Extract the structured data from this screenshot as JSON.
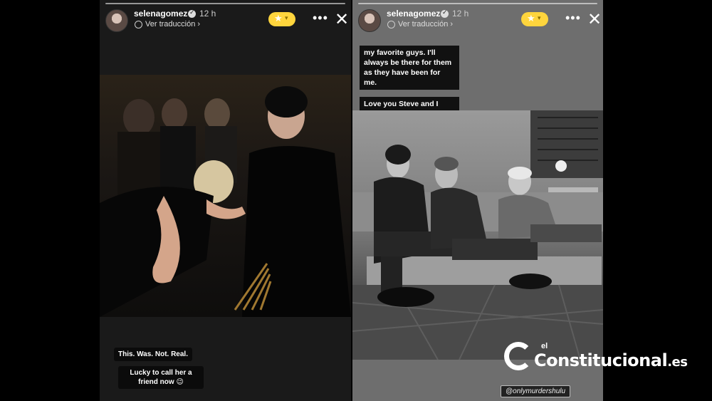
{
  "stories": [
    {
      "username": "selenagomez",
      "time": "12 h",
      "translate": "Ver traducción",
      "captions": [
        "This. Was. Not. Real.",
        "Lucky to call her a friend now 😉"
      ]
    },
    {
      "username": "selenagomez",
      "time": "12 h",
      "translate": "Ver traducción",
      "captions": [
        "my favorite guys. I'll always be there for them as they have been for me.",
        "Love you Steve and I love you Marty"
      ],
      "mention": "@onlymurdershulu"
    }
  ],
  "watermark": {
    "prefix": "el",
    "name": "Constitucional",
    "suffix": ".es"
  },
  "colors": {
    "fav_badge": "#ffd53d",
    "story_bg_left": "#1a1a1a",
    "story_bg_right": "#6e6e6e"
  },
  "icons": [
    "verified-icon",
    "globe-icon",
    "star-icon",
    "more-icon",
    "close-icon"
  ]
}
